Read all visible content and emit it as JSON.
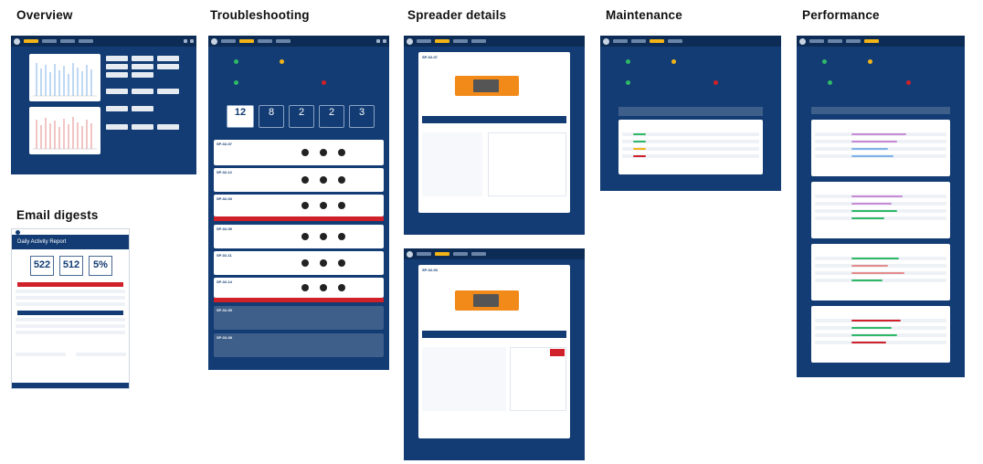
{
  "sections": {
    "overview": "Overview",
    "troubleshooting": "Troubleshooting",
    "spreader_details": "Spreader details",
    "maintenance": "Maintenance",
    "performance": "Performance",
    "email_digests": "Email digests"
  },
  "email": {
    "title": "Daily Activity Report",
    "stats": [
      {
        "value": "522"
      },
      {
        "value": "512"
      },
      {
        "value": "5%"
      }
    ]
  },
  "troubleshooting": {
    "stats": [
      "12",
      "8",
      "2",
      "2",
      "3"
    ],
    "cards": [
      "SP-02-07",
      "SP-02-12",
      "SP-02-03",
      "SP-02-09",
      "SP-02-11",
      "SP-02-14",
      "SP-02-05",
      "SP-02-08"
    ]
  },
  "spreader": {
    "id_top": "SP-02-07",
    "id_bottom": "SP-02-03"
  },
  "colors": {
    "navy": "#123c73",
    "accent_yellow": "#f2b417",
    "alert_red": "#d0202a",
    "ok_green": "#2fb866",
    "machine_orange": "#f28a1a"
  }
}
